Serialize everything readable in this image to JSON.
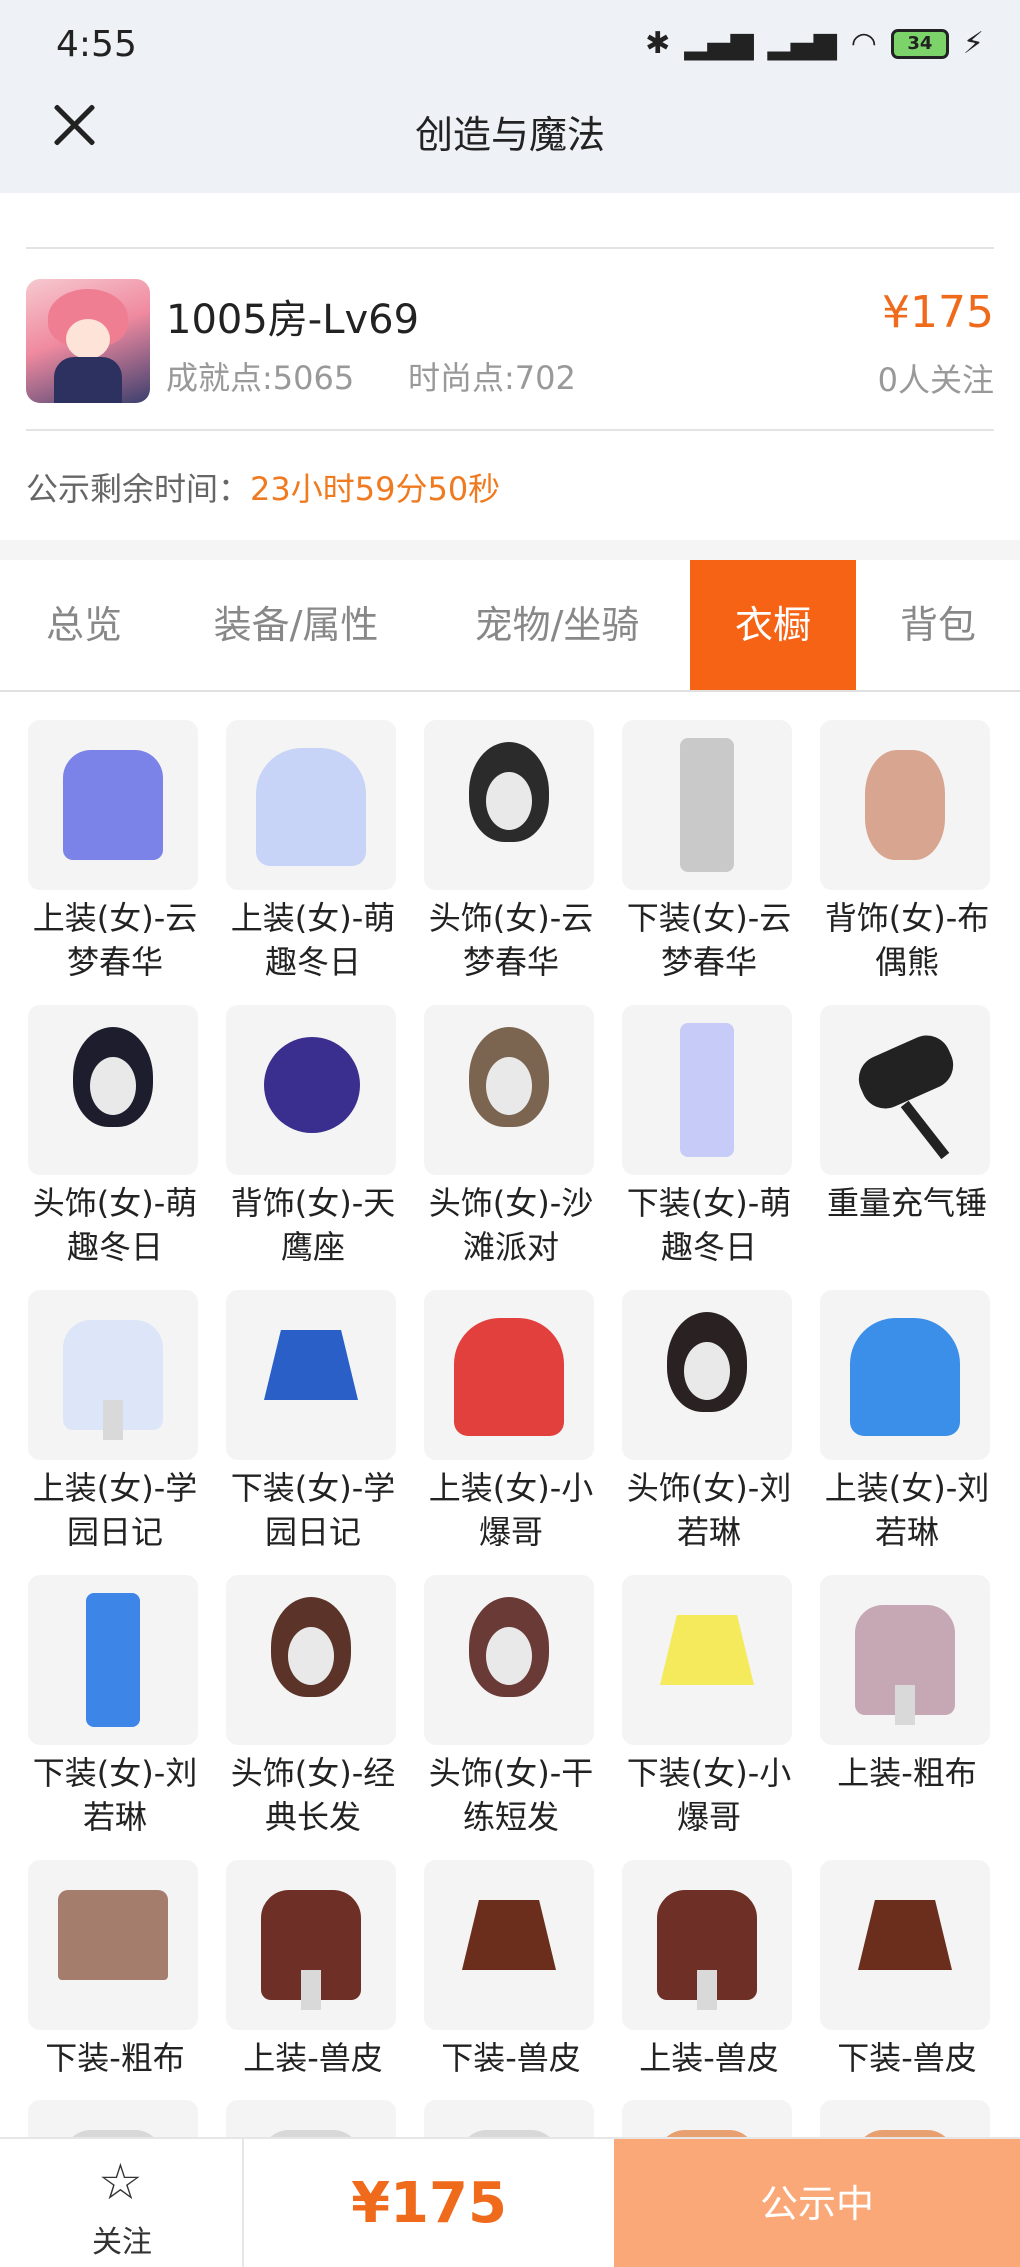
{
  "status_bar": {
    "time": "4:55",
    "battery": "34"
  },
  "header": {
    "title": "创造与魔法"
  },
  "item": {
    "seller_name": "1005房-Lv69",
    "achievement": "成就点:5065",
    "fashion": "时尚点:702",
    "price": "¥175",
    "followers": "0人关注"
  },
  "notice": {
    "label": "公示剩余时间：",
    "countdown": "23小时59分50秒"
  },
  "tabs": [
    {
      "label": "总览"
    },
    {
      "label": "装备/属性"
    },
    {
      "label": "宠物/坐骑"
    },
    {
      "label": "衣橱",
      "active": true
    },
    {
      "label": "背包"
    }
  ],
  "wardrobe": [
    {
      "line1": "上装(女)-云",
      "line2": "梦春华",
      "icon": "dress-icon",
      "color": "#7b83e8"
    },
    {
      "line1": "上装(女)-萌",
      "line2": "趣冬日",
      "icon": "jacket-icon",
      "color": "#c7d3f7"
    },
    {
      "line1": "头饰(女)-云",
      "line2": "梦春华",
      "icon": "hair-icon",
      "color": "#2b2b2b"
    },
    {
      "line1": "下装(女)-云",
      "line2": "梦春华",
      "icon": "legs-icon",
      "color": "#c9c9c9"
    },
    {
      "line1": "背饰(女)-布",
      "line2": "偶熊",
      "icon": "teddy-bear-icon",
      "color": "#d8a690"
    },
    {
      "line1": "头饰(女)-萌",
      "line2": "趣冬日",
      "icon": "hair-icon",
      "color": "#1d1d2e"
    },
    {
      "line1": "背饰(女)-天",
      "line2": "鹰座",
      "icon": "orb-icon",
      "color": "#3a2f8e"
    },
    {
      "line1": "头饰(女)-沙",
      "line2": "滩派对",
      "icon": "hat-icon",
      "color": "#7b6550"
    },
    {
      "line1": "下装(女)-萌",
      "line2": "趣冬日",
      "icon": "legs-icon",
      "color": "#c7cbf7"
    },
    {
      "line1": "重量充气锤",
      "line2": "",
      "icon": "hammer-icon",
      "color": "#222222"
    },
    {
      "line1": "上装(女)-学",
      "line2": "园日记",
      "icon": "shirt-icon",
      "color": "#dde6f8"
    },
    {
      "line1": "下装(女)-学",
      "line2": "园日记",
      "icon": "skirt-icon",
      "color": "#2a5fc7"
    },
    {
      "line1": "上装(女)-小",
      "line2": "爆哥",
      "icon": "hoodie-icon",
      "color": "#e2403d"
    },
    {
      "line1": "头饰(女)-刘",
      "line2": "若琳",
      "icon": "hair-icon",
      "color": "#2a2222"
    },
    {
      "line1": "上装(女)-刘",
      "line2": "若琳",
      "icon": "hoodie-icon",
      "color": "#3b8fe8"
    },
    {
      "line1": "下装(女)-刘",
      "line2": "若琳",
      "icon": "legs-icon",
      "color": "#3d86e8"
    },
    {
      "line1": "头饰(女)-经",
      "line2": "典长发",
      "icon": "hair-icon",
      "color": "#5b3328"
    },
    {
      "line1": "头饰(女)-干",
      "line2": "练短发",
      "icon": "hair-icon",
      "color": "#6a3a36"
    },
    {
      "line1": "下装(女)-小",
      "line2": "爆哥",
      "icon": "skirt-icon",
      "color": "#f4ea5c"
    },
    {
      "line1": "上装-粗布",
      "line2": "",
      "icon": "shirt-icon",
      "color": "#c6a8b4"
    },
    {
      "line1": "下装-粗布",
      "line2": "",
      "icon": "shorts-icon",
      "color": "#a57d6c"
    },
    {
      "line1": "上装-兽皮",
      "line2": "",
      "icon": "shirt-icon",
      "color": "#6e2f26"
    },
    {
      "line1": "下装-兽皮",
      "line2": "",
      "icon": "skirt-icon",
      "color": "#6b2e1c"
    },
    {
      "line1": "上装-兽皮",
      "line2": "",
      "icon": "shirt-icon",
      "color": "#6e2f26"
    },
    {
      "line1": "下装-兽皮",
      "line2": "",
      "icon": "skirt-icon",
      "color": "#6b2e1c"
    },
    {
      "line1": "",
      "line2": "",
      "icon": "shirt-icon",
      "color": "#d8d8d8"
    },
    {
      "line1": "",
      "line2": "",
      "icon": "shirt-icon",
      "color": "#d8d8d8"
    },
    {
      "line1": "",
      "line2": "",
      "icon": "shirt-icon",
      "color": "#d8d8d8"
    },
    {
      "line1": "",
      "line2": "",
      "icon": "shirt-icon",
      "color": "#e8a070"
    },
    {
      "line1": "",
      "line2": "",
      "icon": "shirt-icon",
      "color": "#e8a070"
    }
  ],
  "bottom_bar": {
    "follow_label": "关注",
    "price": "¥175",
    "status_label": "公示中"
  },
  "colors": {
    "accent": "#f76314",
    "price": "#f06a1c",
    "countdown": "#ef7a1f"
  }
}
